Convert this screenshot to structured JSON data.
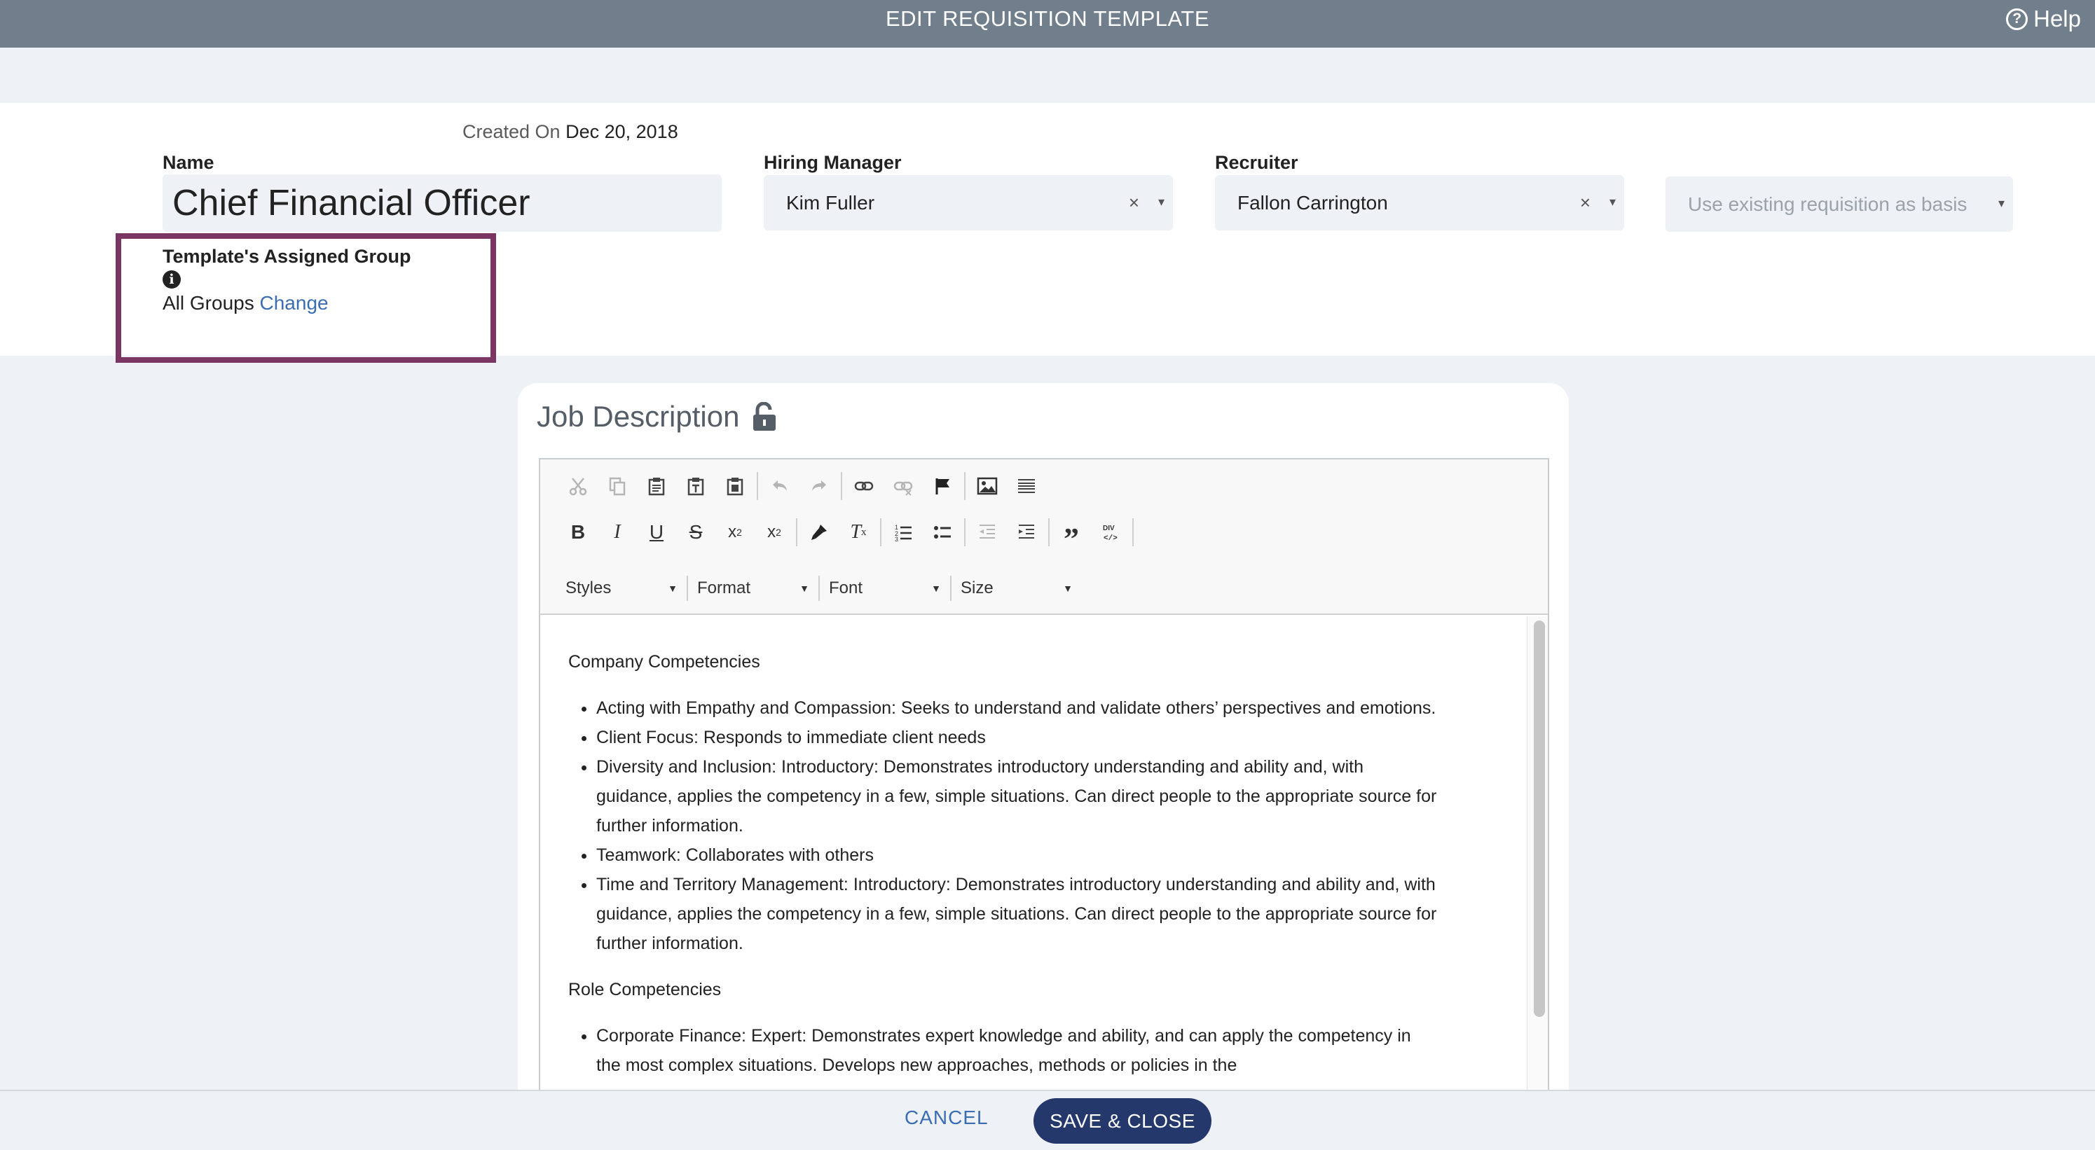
{
  "window": {
    "title": "EDIT REQUISITION TEMPLATE",
    "help_label": "Help",
    "help_icon": "question-circle-icon"
  },
  "form": {
    "created_label": "Created On",
    "created_value": "Dec 20, 2018",
    "name_label": "Name",
    "name_value": "Chief Financial Officer",
    "hiring_manager_label": "Hiring Manager",
    "hiring_manager_value": "Kim Fuller",
    "recruiter_label": "Recruiter",
    "recruiter_value": "Fallon Carrington",
    "basis_placeholder": "Use existing requisition as basis",
    "clear_glyph": "×",
    "caret_glyph": "▾"
  },
  "group": {
    "title": "Template's Assigned Group",
    "value": "All Groups",
    "change_link": "Change",
    "highlight_color": "#7b3563"
  },
  "job_description": {
    "title": "Job Description",
    "lock_icon": "unlock-icon",
    "combos": [
      {
        "label": "Styles"
      },
      {
        "label": "Format"
      },
      {
        "label": "Font"
      },
      {
        "label": "Size"
      }
    ],
    "content": {
      "section1_heading": "Company Competencies",
      "section1_items": [
        "Acting with Empathy and Compassion: Seeks to understand and validate others’ perspectives and emotions.",
        "Client Focus: Responds to immediate client needs",
        "Diversity and Inclusion: Introductory: Demonstrates introductory understanding and ability and, with guidance, applies the competency in a few, simple situations. Can direct people to the appropriate source for further information.",
        "Teamwork: Collaborates with others",
        "Time and Territory Management: Introductory: Demonstrates introductory understanding and ability and, with guidance, applies the competency in a few, simple situations. Can direct people to the appropriate source for further information."
      ],
      "section2_heading": "Role Competencies",
      "section2_items": [
        "Corporate Finance: Expert: Demonstrates expert knowledge and ability, and can apply the competency in the most complex situations. Develops new approaches, methods or policies in the"
      ]
    }
  },
  "footer": {
    "cancel_label": "CANCEL",
    "save_label": "SAVE & CLOSE",
    "save_color": "#24386b"
  }
}
